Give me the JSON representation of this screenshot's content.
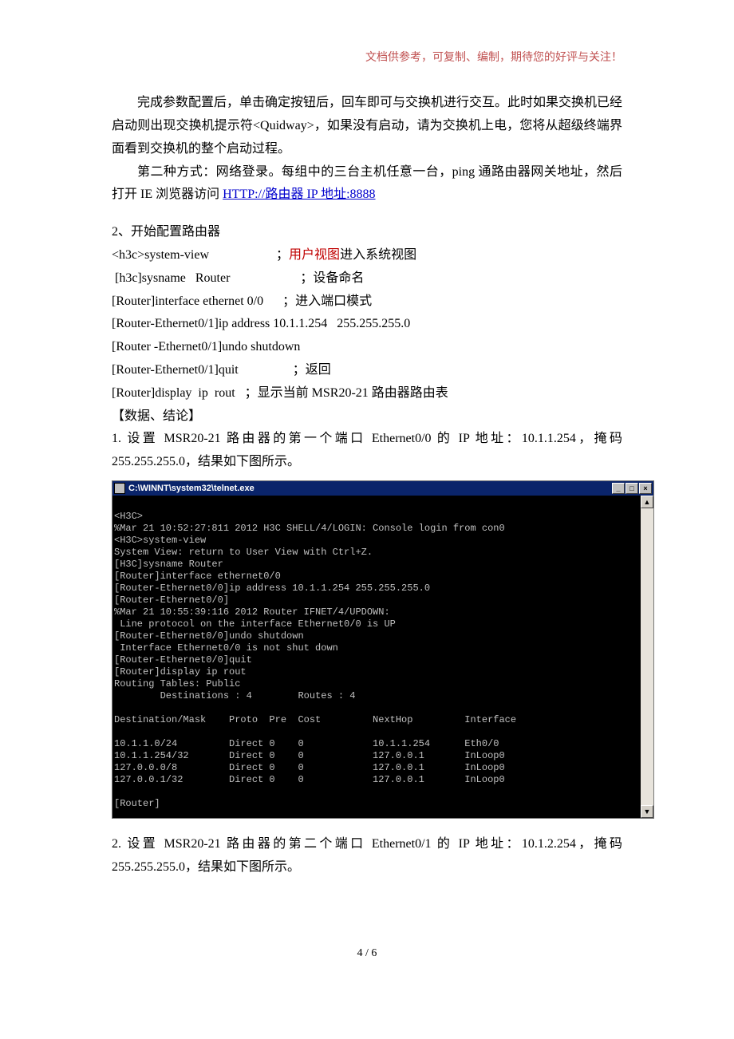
{
  "header_note": "文档供参考，可复制、编制，期待您的好评与关注！",
  "para1": "完成参数配置后，单击确定按钮后，回车即可与交换机进行交互。此时如果交换机已经启动则出现交换机提示符<Quidway>，如果没有启动，请为交换机上电，您将从超级终端界面看到交换机的整个启动过程。",
  "para2_prefix": "第二种方式：网络登录。每组中的三台主机任意一台，ping 通路由器网关地址，然后打开 IE 浏览器访问 ",
  "para2_link": "HTTP://路由器 IP 地址:8888",
  "section_title": "2、开始配置路由器",
  "cmds": [
    {
      "left": "<h3c>system-view",
      "right": "；",
      "red": "用户视图",
      "tail": "进入系统视图"
    },
    {
      "left": " [h3c]sysname   Router",
      "right": "；设备命名"
    },
    {
      "left": "[Router]interface ethernet 0/0      ",
      "right": "；进入端口模式"
    },
    {
      "left": "[Router-Ethernet0/1]ip address 10.1.1.254   255.255.255.0",
      "right": ""
    },
    {
      "left": "[Router -Ethernet0/1]undo shutdown",
      "right": ""
    },
    {
      "left": "[Router-Ethernet0/1]quit                 ",
      "right": "；返回"
    },
    {
      "left": "[Router]display  ip  rout   ",
      "right": "；显示当前 MSR20-21 路由器路由表"
    }
  ],
  "data_heading": "【数据、结论】",
  "list1_num": "1.",
  "list1_text": "设置 MSR20-21 路由器的第一个端口 Ethernet0/0 的 IP 地址：10.1.1.254，掩码255.255.255.0，结果如下图所示。",
  "terminal": {
    "title": "C:\\WINNT\\system32\\telnet.exe",
    "btn_min": "_",
    "btn_max": "□",
    "btn_close": "×",
    "scroll_up": "▲",
    "scroll_down": "▼",
    "lines": [
      "",
      "<H3C>",
      "%Mar 21 10:52:27:811 2012 H3C SHELL/4/LOGIN: Console login from con0",
      "<H3C>system-view",
      "System View: return to User View with Ctrl+Z.",
      "[H3C]sysname Router",
      "[Router]interface ethernet0/0",
      "[Router-Ethernet0/0]ip address 10.1.1.254 255.255.255.0",
      "[Router-Ethernet0/0]",
      "%Mar 21 10:55:39:116 2012 Router IFNET/4/UPDOWN:",
      " Line protocol on the interface Ethernet0/0 is UP",
      "[Router-Ethernet0/0]undo shutdown",
      " Interface Ethernet0/0 is not shut down",
      "[Router-Ethernet0/0]quit",
      "[Router]display ip rout",
      "Routing Tables: Public",
      "        Destinations : 4        Routes : 4",
      "",
      "Destination/Mask    Proto  Pre  Cost         NextHop         Interface",
      "",
      "10.1.1.0/24         Direct 0    0            10.1.1.254      Eth0/0",
      "10.1.1.254/32       Direct 0    0            127.0.0.1       InLoop0",
      "127.0.0.0/8         Direct 0    0            127.0.0.1       InLoop0",
      "127.0.0.1/32        Direct 0    0            127.0.0.1       InLoop0",
      "",
      "[Router]",
      ""
    ]
  },
  "list2_num": "2.",
  "list2_text": "设置 MSR20-21 路由器的第二个端口 Ethernet0/1 的 IP 地址：10.1.2.254，掩码255.255.255.0，结果如下图所示。",
  "footer": "4 / 6"
}
